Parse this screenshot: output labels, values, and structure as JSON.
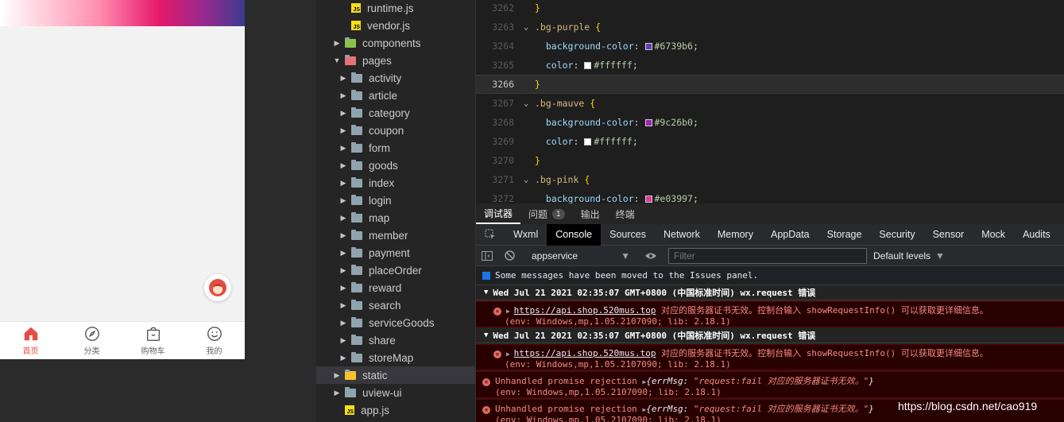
{
  "phone": {
    "tabs": [
      {
        "label": "首页",
        "icon": "home-icon",
        "active": true
      },
      {
        "label": "分类",
        "icon": "compass-icon",
        "active": false
      },
      {
        "label": "购物车",
        "icon": "cart-bag-icon",
        "active": false
      },
      {
        "label": "我的",
        "icon": "smiley-icon",
        "active": false
      }
    ],
    "accent": "#e54d42"
  },
  "file_tree": {
    "items": [
      {
        "label": "runtime.js",
        "type": "js"
      },
      {
        "label": "vendor.js",
        "type": "js"
      },
      {
        "label": "components",
        "type": "folder"
      },
      {
        "label": "pages",
        "type": "folder"
      },
      {
        "label": "activity",
        "type": "folder"
      },
      {
        "label": "article",
        "type": "folder"
      },
      {
        "label": "category",
        "type": "folder"
      },
      {
        "label": "coupon",
        "type": "folder"
      },
      {
        "label": "form",
        "type": "folder"
      },
      {
        "label": "goods",
        "type": "folder"
      },
      {
        "label": "index",
        "type": "folder"
      },
      {
        "label": "login",
        "type": "folder"
      },
      {
        "label": "map",
        "type": "folder"
      },
      {
        "label": "member",
        "type": "folder"
      },
      {
        "label": "payment",
        "type": "folder"
      },
      {
        "label": "placeOrder",
        "type": "folder"
      },
      {
        "label": "reward",
        "type": "folder"
      },
      {
        "label": "search",
        "type": "folder"
      },
      {
        "label": "serviceGoods",
        "type": "folder"
      },
      {
        "label": "share",
        "type": "folder"
      },
      {
        "label": "storeMap",
        "type": "folder"
      },
      {
        "label": "static",
        "type": "folder"
      },
      {
        "label": "uview-ui",
        "type": "folder"
      },
      {
        "label": "app.js",
        "type": "js"
      }
    ]
  },
  "editor": {
    "lines": [
      {
        "num": "3262",
        "code": "}"
      },
      {
        "num": "3263",
        "selector": ".bg-purple",
        "open": " {"
      },
      {
        "num": "3264",
        "prop": "background-color",
        "hex": "#6739b6",
        "swatch": "#6739b6"
      },
      {
        "num": "3265",
        "prop": "color",
        "hex": "#ffffff",
        "swatch": "#ffffff"
      },
      {
        "num": "3266",
        "code": "}"
      },
      {
        "num": "3267",
        "selector": ".bg-mauve",
        "open": " {"
      },
      {
        "num": "3268",
        "prop": "background-color",
        "hex": "#9c26b0",
        "swatch": "#9c26b0"
      },
      {
        "num": "3269",
        "prop": "color",
        "hex": "#ffffff",
        "swatch": "#ffffff"
      },
      {
        "num": "3270",
        "code": "}"
      },
      {
        "num": "3271",
        "selector": ".bg-pink",
        "open": " {"
      },
      {
        "num": "3272",
        "prop": "background-color",
        "hex": "#e03997",
        "swatch": "#e03997"
      }
    ]
  },
  "devtools": {
    "top_tabs": [
      "调试器",
      "问题",
      "输出",
      "终端"
    ],
    "issues_count": "1",
    "panel_tabs": [
      "Wxml",
      "Console",
      "Sources",
      "Network",
      "Memory",
      "AppData",
      "Storage",
      "Security",
      "Sensor",
      "Mock",
      "Audits"
    ],
    "active_panel": "Console",
    "context": "appservice",
    "filter_placeholder": "Filter",
    "levels": "Default levels",
    "messages": {
      "info": "Some messages have been moved to the Issues panel.",
      "group1": "Wed Jul 21 2021 02:35:07 GMT+0800 (中国标准时间) wx.request 错误",
      "err1_url": "https://api.shop.520mus.top",
      "err1_text": " 对应的服务器证书无效。控制台输入 showRequestInfo() 可以获取更详细信息。",
      "err1_env": "(env: Windows,mp,1.05.2107090; lib: 2.18.1)",
      "group2": "Wed Jul 21 2021 02:35:07 GMT+0800 (中国标准时间) wx.request 错误",
      "err2_url": "https://api.shop.520mus.top",
      "err2_text": " 对应的服务器证书无效。控制台输入 showRequestInfo() 可以获取更详细信息。",
      "err2_env": "(env: Windows,mp,1.05.2107090; lib: 2.18.1)",
      "rej1_label": "Unhandled promise rejection ",
      "rej1_key": "{errMsg: ",
      "rej1_val": "\"request:fail 对应的服务器证书无效。\"",
      "rej1_close": "}",
      "rej1_env": "(env: Windows,mp,1.05.2107090; lib: 2.18.1)",
      "rej2_label": "Unhandled promise rejection ",
      "rej2_key": "{errMsg: ",
      "rej2_val": "\"request:fail 对应的服务器证书无效。\"",
      "rej2_close": "}",
      "rej2_env": "(env: Windows,mp,1.05.2107090; lib: 2.18.1)"
    }
  },
  "watermark": "https://blog.csdn.net/cao919"
}
